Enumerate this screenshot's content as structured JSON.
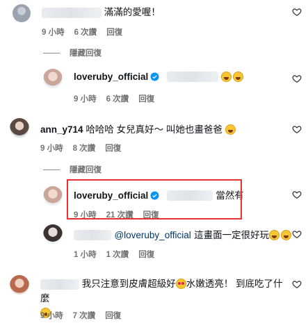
{
  "comments": [
    {
      "id": "c1",
      "text": "滿滿的愛喔！",
      "time": "9 小時",
      "likes": "6 次讚",
      "reply": "回復",
      "hide_replies": "隱藏回復",
      "replies": [
        {
          "username": "loveruby_official",
          "time": "9 小時",
          "likes": "6 次讚",
          "reply": "回復"
        }
      ]
    },
    {
      "id": "c2",
      "username": "ann_y714",
      "text": "哈哈哈 女兒真好～ 叫她也畫爸爸",
      "time": "9 小時",
      "likes": "8 次讚",
      "reply": "回復",
      "hide_replies": "隱藏回復",
      "replies": [
        {
          "username": "loveruby_official",
          "text": "當然有",
          "time": "9 小時",
          "likes": "21 次讚",
          "reply": "回復"
        },
        {
          "mention": "@loveruby_official",
          "text": "這畫面一定很好玩",
          "time": "1 小時",
          "likes": "1 次讚",
          "reply": "回復"
        }
      ]
    },
    {
      "id": "c3",
      "text": "我只注意到皮膚超級好",
      "text2": "水嫩透亮！ 到底吃了什麼",
      "time": "9 小時",
      "likes": "7 次讚",
      "reply": "回復"
    }
  ],
  "colors": {
    "verified": "#0095f6",
    "highlight": "#e8312f",
    "muted": "#737373"
  }
}
